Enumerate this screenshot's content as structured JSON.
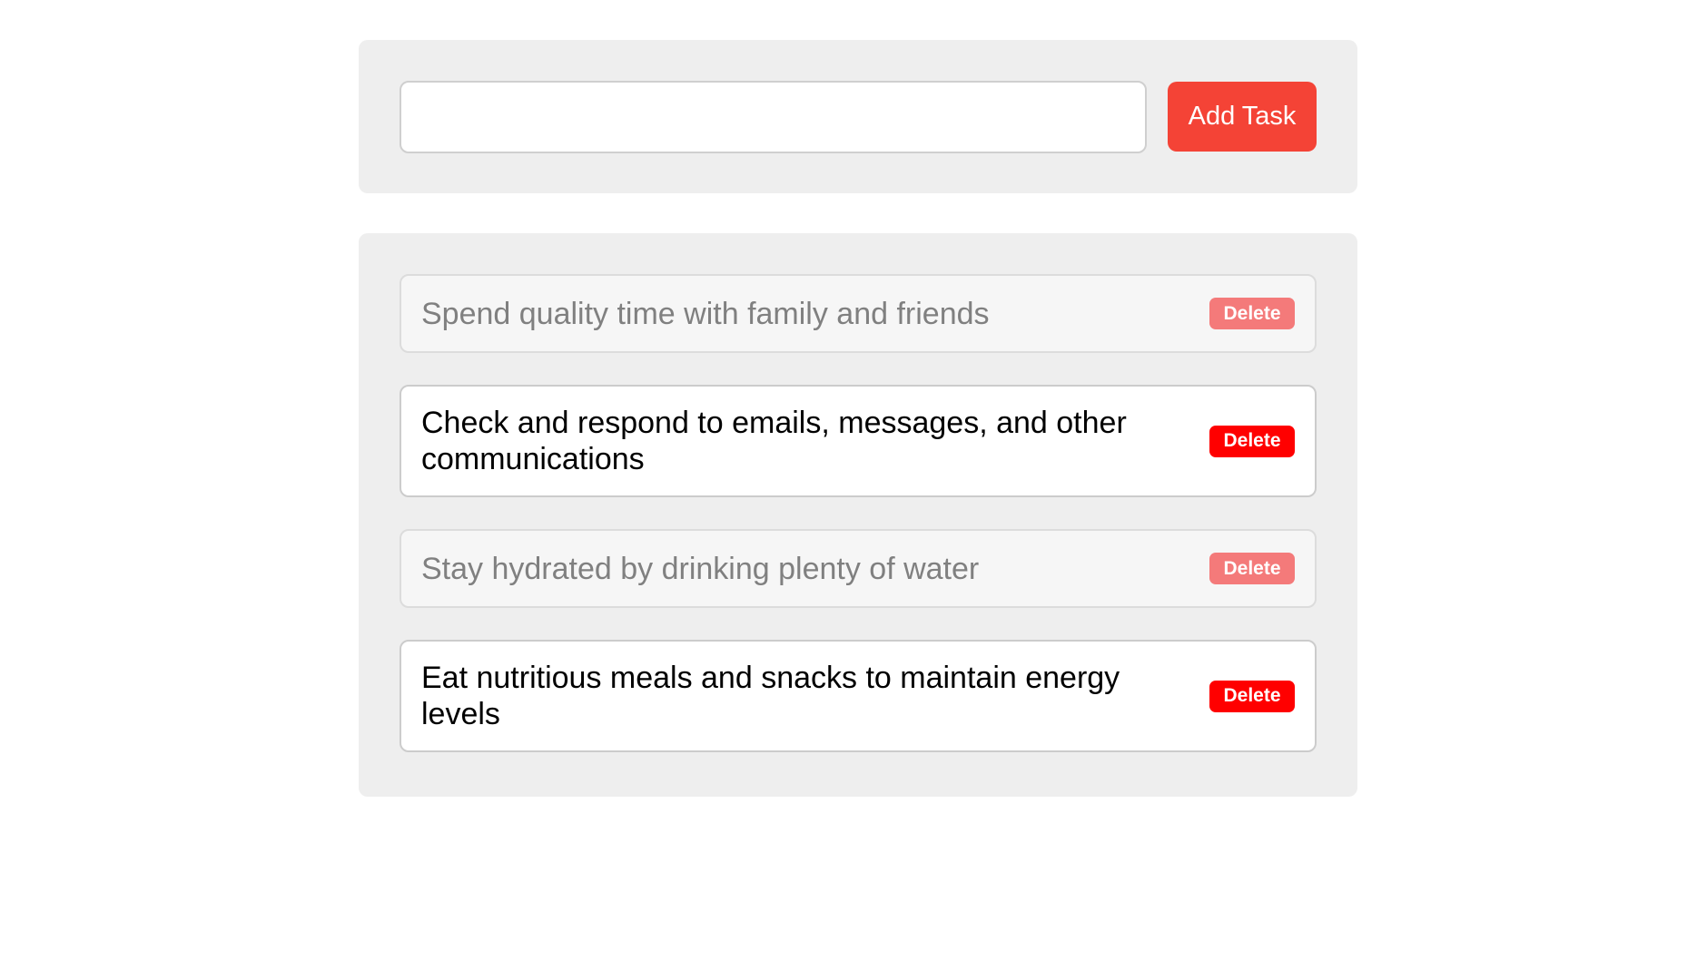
{
  "add_form": {
    "input_value": "",
    "input_placeholder": "",
    "add_button_label": "Add Task"
  },
  "tasks": [
    {
      "text": "Spend quality time with family and friends",
      "completed": true,
      "delete_label": "Delete"
    },
    {
      "text": "Check and respond to emails, messages, and other communications",
      "completed": false,
      "delete_label": "Delete"
    },
    {
      "text": "Stay hydrated by drinking plenty of water",
      "completed": true,
      "delete_label": "Delete"
    },
    {
      "text": "Eat nutritious meals and snacks to maintain energy levels",
      "completed": false,
      "delete_label": "Delete"
    }
  ],
  "colors": {
    "accent": "#f44336",
    "delete": "#ff0000",
    "delete_completed": "#f47a7a",
    "panel_bg": "#eeeeee"
  }
}
